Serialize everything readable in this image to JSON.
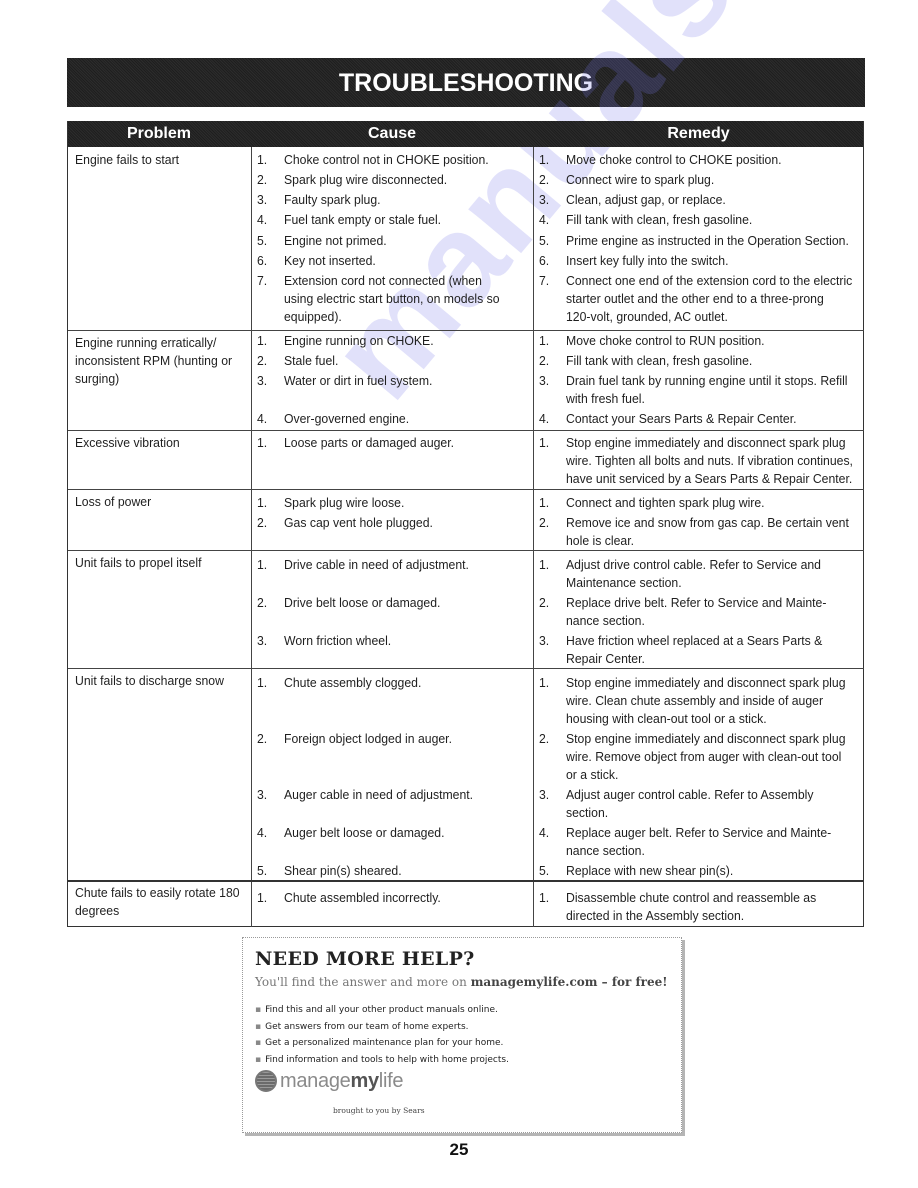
{
  "page": {
    "title": "TROUBLESHOOTING",
    "page_number": "25",
    "watermark": "manualshive.com"
  },
  "table": {
    "headers": [
      "Problem",
      "Cause",
      "Remedy"
    ],
    "rows": [
      {
        "problem": [
          "Engine fails to start"
        ],
        "causes": [
          [
            "Choke control not in CHOKE position."
          ],
          [
            "Spark plug wire disconnected."
          ],
          [
            "Faulty spark plug."
          ],
          [
            "Fuel tank empty or stale fuel."
          ],
          [
            "Engine not primed."
          ],
          [
            "Key not inserted."
          ],
          [
            "Extension cord not connected (when",
            "using electric start button, on models so",
            "equipped)."
          ]
        ],
        "remedies": [
          [
            "Move choke control to CHOKE position."
          ],
          [
            "Connect wire to spark plug."
          ],
          [
            "Clean, adjust gap, or replace."
          ],
          [
            "Fill tank with clean, fresh gasoline."
          ],
          [
            "Prime engine as instructed in the Operation Section."
          ],
          [
            "Insert key fully into the switch."
          ],
          [
            "Connect one end of the extension cord to the electric",
            "starter outlet and the other end to a three-prong",
            "120-volt, grounded, AC outlet."
          ]
        ]
      },
      {
        "problem": [
          "Engine running erratically/",
          "inconsistent RPM (hunting or",
          "surging)"
        ],
        "causes": [
          [
            "Engine running on CHOKE."
          ],
          [
            "Stale fuel."
          ],
          [
            "Water or dirt in fuel system."
          ],
          [
            "Over-governed engine."
          ]
        ],
        "remedies": [
          [
            "Move choke control to RUN position."
          ],
          [
            "Fill tank with clean, fresh gasoline."
          ],
          [
            "Drain fuel tank by running engine until it stops. Refill",
            "with fresh fuel."
          ],
          [
            "Contact your Sears Parts & Repair Center."
          ]
        ]
      },
      {
        "problem": [
          "Excessive vibration"
        ],
        "causes": [
          [
            "Loose parts or damaged auger."
          ]
        ],
        "remedies": [
          [
            "Stop engine immediately and disconnect spark plug",
            "wire. Tighten all bolts and nuts. If vibration continues,",
            "have unit serviced by a Sears Parts & Repair Center."
          ]
        ]
      },
      {
        "problem": [
          "Loss of power"
        ],
        "causes": [
          [
            "Spark plug wire loose."
          ],
          [
            "Gas cap vent hole plugged."
          ]
        ],
        "remedies": [
          [
            "Connect and tighten spark plug wire."
          ],
          [
            "Remove ice and snow from gas cap. Be certain vent",
            "hole is clear."
          ]
        ]
      },
      {
        "problem": [
          "Unit fails to propel itself"
        ],
        "causes": [
          [
            "Drive cable in need of adjustment."
          ],
          [
            "Drive belt loose or damaged."
          ],
          [
            "Worn friction wheel."
          ]
        ],
        "remedies": [
          [
            "Adjust drive control cable. Refer to Service and",
            "Maintenance section."
          ],
          [
            "Replace drive belt. Refer to Service and Mainte-",
            "nance section."
          ],
          [
            "Have friction wheel replaced at a Sears Parts &",
            "Repair Center."
          ]
        ]
      },
      {
        "problem": [
          "Unit fails to discharge snow"
        ],
        "causes": [
          [
            "Chute assembly clogged."
          ],
          [
            "Foreign object lodged in auger."
          ],
          [
            "Auger cable in need of adjustment."
          ],
          [
            "Auger belt loose or damaged."
          ],
          [
            "Shear pin(s) sheared."
          ]
        ],
        "remedies": [
          [
            "Stop engine immediately and disconnect spark plug",
            "wire. Clean chute assembly and inside of auger",
            "housing with clean-out tool or a stick."
          ],
          [
            "Stop engine immediately and disconnect spark plug",
            "wire. Remove object from auger with clean-out tool",
            "or a stick."
          ],
          [
            "Adjust auger control cable. Refer to Assembly",
            "section."
          ],
          [
            "Replace auger belt. Refer to Service and Mainte-",
            "nance section."
          ],
          [
            "Replace with new shear pin(s)."
          ]
        ]
      },
      {
        "problem": [
          "Chute fails to easily rotate 180",
          "degrees"
        ],
        "causes": [
          [
            "Chute assembled incorrectly."
          ]
        ],
        "remedies": [
          [
            "Disassemble chute control and reassemble as",
            "directed in the Assembly section."
          ]
        ]
      }
    ]
  },
  "help_box": {
    "title": "NEED MORE HELP?",
    "subtitle_prefix": "You'll find the answer and more on ",
    "subtitle_site": "managemylife.com",
    "subtitle_suffix": " – for free!",
    "bullets": [
      "Find this and all your other product manuals online.",
      "Get answers from our team of home experts.",
      "Get a personalized maintenance plan for your home.",
      "Find information and tools to help with home projects."
    ],
    "logo": {
      "part1": "manage",
      "part2": "my",
      "part3": "life"
    },
    "tagline": "brought to you by Sears"
  }
}
